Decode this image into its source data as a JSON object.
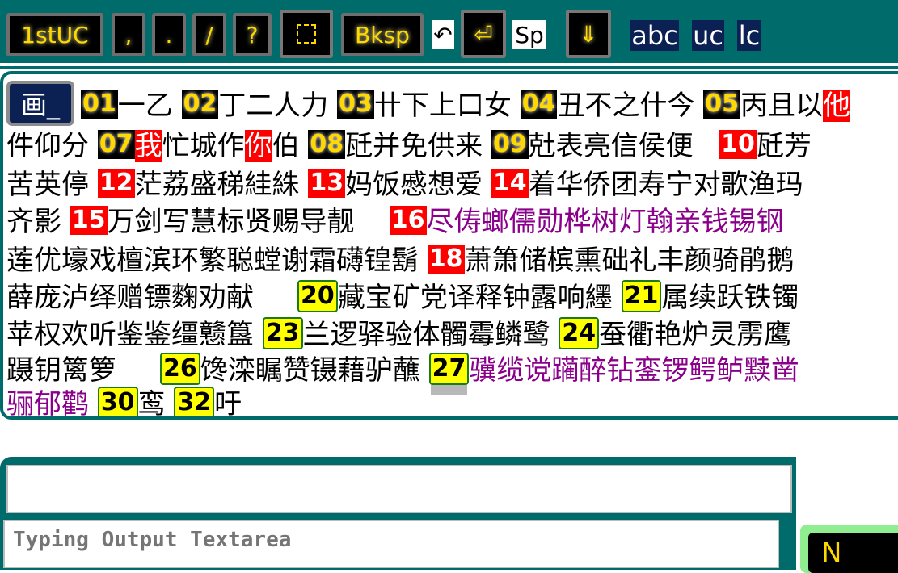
{
  "toolbar": {
    "first_uc": "1stUC",
    "comma": ",",
    "period": ".",
    "slash": "/",
    "question": "?",
    "select_icon": "dotted-square",
    "bksp": "Bksp",
    "undo_icon": "↶",
    "enter_icon": "⏎",
    "space": "Sp",
    "down_icon": "⇓",
    "abc": "abc",
    "uc": "uc",
    "lc": "lc"
  },
  "panel": {
    "mode_label": "画_",
    "rows": [
      "01 一乙 02 丁二人力 03 卄下上口女 04 丑不之什今 05 丙且以他",
      "件仰分 07 我 忙城作你伯 08 瓩并免供来 09 兙表亮信侯便 10 瓩芳",
      "苦英停 12 茫荔盛稊絓絑 13 妈饭慼想爱 14 着华侨团寿宁对歌渔玛",
      "齐影 15 万剑写慧标贤赐导靓 16 尽俦螂儒勋桦树灯翰亲钱锡钢",
      "莲优壕戏檀滨环繁聪螳谢霜礴锽鬍 18 萧箫储槟熏础礼丰颜骑鹃鹅",
      "薛庞泸绎赠镖麴劝献 20 藏宝矿党译释钟露响纆 21 属续跃铁镯",
      "苹权欢听鉴鉴缰戆簋 23 兰逻驿验体髑霉鳞鹭 24 蚕衢艳炉灵雳鹰",
      "蹑钥篱箩 26 馋滦瞩赞镊藉驴蘸 27 骥缆谠躏醉钻銮锣鳄鲈黩凿",
      "骊郁鹳 30 鸾 32 吁"
    ]
  },
  "output": {
    "placeholder": "Typing Output Textarea",
    "side_label": "N"
  }
}
